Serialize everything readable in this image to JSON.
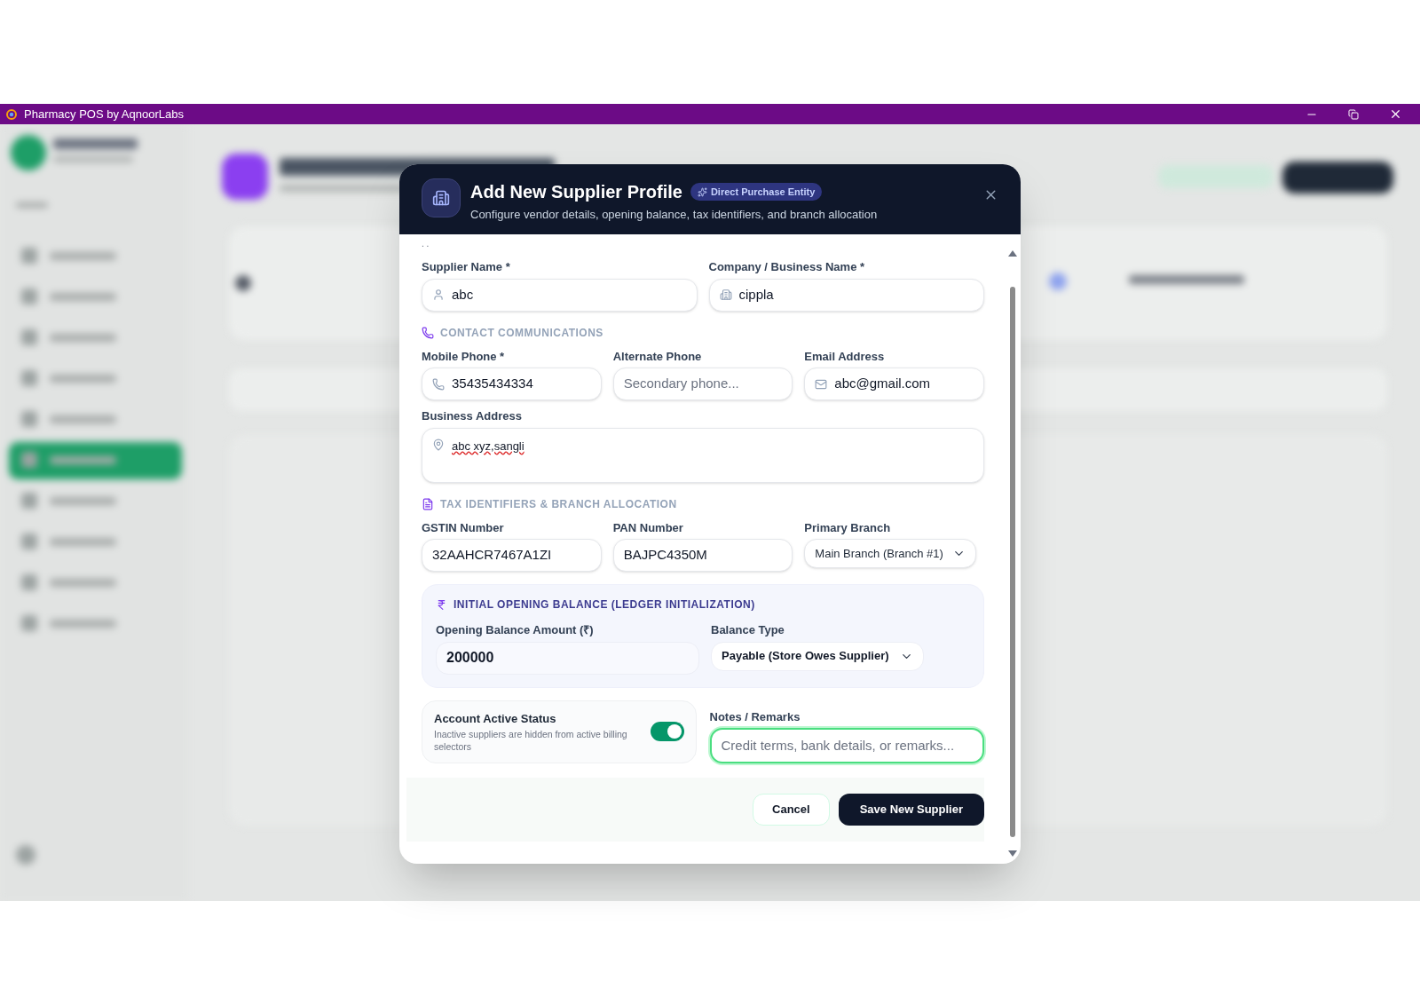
{
  "window": {
    "title": "Pharmacy POS by AqnoorLabs"
  },
  "modal": {
    "title": "Add New Supplier Profile",
    "badge": "Direct Purchase Entity",
    "subtitle": "Configure vendor details, opening balance, tax identifiers, and branch allocation",
    "clipped_text": ". ."
  },
  "identity": [
    {
      "kind": "person",
      "label": "Supplier Name *",
      "value": "abc"
    },
    {
      "kind": "company",
      "label": "Company / Business Name *",
      "value": "cippla"
    }
  ],
  "contact": {
    "heading": "CONTACT COMMUNICATIONS",
    "fields": [
      {
        "kind": "phone",
        "label": "Mobile Phone *",
        "value": "35435434334"
      },
      {
        "kind": "plain",
        "label": "Alternate Phone",
        "placeholder": "Secondary phone..."
      },
      {
        "kind": "email",
        "label": "Email Address",
        "value": "abc@gmail.com"
      }
    ],
    "address": {
      "label": "Business Address",
      "value": "abc xyz,sangli",
      "spell_flagged": true
    }
  },
  "tax": {
    "heading": "TAX IDENTIFIERS & BRANCH ALLOCATION",
    "fields": [
      {
        "kind": "plain",
        "label": "GSTIN Number",
        "value": "32AAHCR7467A1ZI"
      },
      {
        "kind": "plain",
        "label": "PAN Number",
        "value": "BAJPC4350M"
      },
      {
        "kind": "select",
        "label": "Primary Branch",
        "value": "Main Branch (Branch #1)"
      }
    ]
  },
  "balance": {
    "heading": "INITIAL OPENING BALANCE (LEDGER INITIALIZATION)",
    "amount": {
      "label": "Opening Balance Amount (₹)",
      "value": "200000"
    },
    "type": {
      "label": "Balance Type",
      "value": "Payable (Store Owes Supplier)"
    }
  },
  "status": {
    "title": "Account Active Status",
    "description": "Inactive suppliers are hidden from active billing selectors",
    "on": true
  },
  "notes": {
    "label": "Notes / Remarks",
    "placeholder": "Credit terms, bank details, or remarks...",
    "focused": true
  },
  "buttons": [
    {
      "kind": "secondary",
      "label": "Cancel"
    },
    {
      "kind": "primary",
      "label": "Save New Supplier"
    }
  ]
}
